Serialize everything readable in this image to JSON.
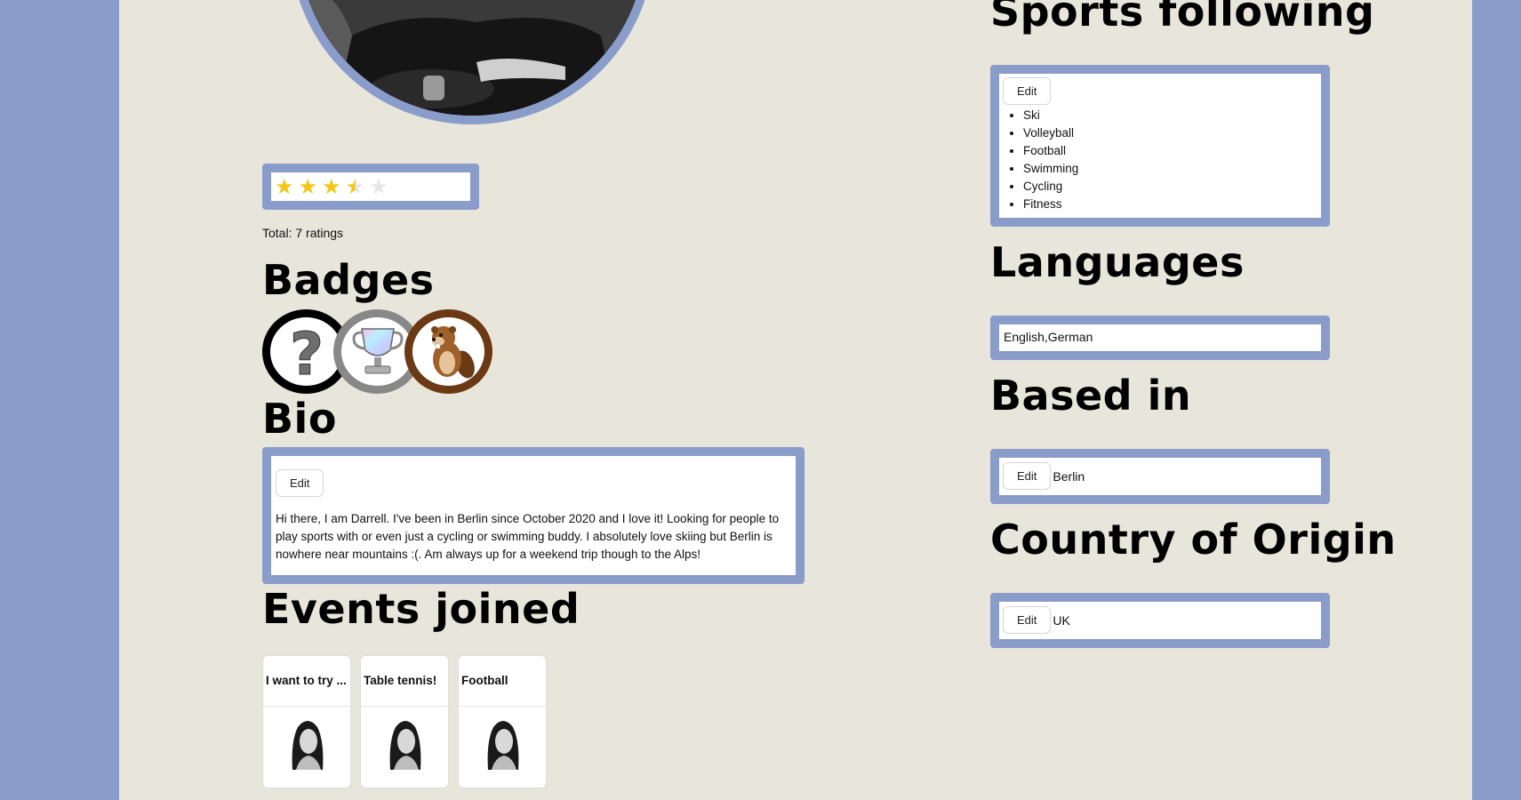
{
  "profile": {
    "rating": {
      "stars": [
        {
          "icon": "star-full-icon",
          "glyph": "★"
        },
        {
          "icon": "star-full-icon",
          "glyph": "★"
        },
        {
          "icon": "star-full-icon",
          "glyph": "★"
        },
        {
          "icon": "star-half-icon",
          "glyph": "★"
        },
        {
          "icon": "star-empty-icon",
          "glyph": "★"
        }
      ],
      "value": 3.5,
      "max": 5,
      "total_text": "Total: 7 ratings"
    }
  },
  "badges": {
    "title": "Badges",
    "items": [
      {
        "icon": "question-mark-icon",
        "ring_color": "#000000"
      },
      {
        "icon": "trophy-icon",
        "ring_color": "#888888"
      },
      {
        "icon": "beaver-icon",
        "ring_color": "#6b3a14"
      }
    ]
  },
  "bio": {
    "title": "Bio",
    "edit_label": "Edit",
    "text": "Hi there, I am Darrell. I've been in Berlin since October 2020 and I love it! Looking for people to play sports with or even just a cycling or swimming buddy. I absolutely love skiing but Berlin is nowhere near mountains :(. Am always up for a weekend trip though to the Alps!"
  },
  "events": {
    "title": "Events joined",
    "items": [
      {
        "title": "I want to try ..."
      },
      {
        "title": "Table tennis!"
      },
      {
        "title": "Football"
      }
    ]
  },
  "sports": {
    "title": "Sports following",
    "edit_label": "Edit",
    "items": [
      "Ski",
      "Volleyball",
      "Football",
      "Swimming",
      "Cycling",
      "Fitness"
    ]
  },
  "languages": {
    "title": "Languages",
    "value": "English,German"
  },
  "based_in": {
    "title": "Based in",
    "edit_label": "Edit",
    "value": "Berlin"
  },
  "country_of_origin": {
    "title": "Country of Origin",
    "edit_label": "Edit",
    "value": "UK"
  },
  "colors": {
    "background": "#8a9cca",
    "page": "#e8e5da",
    "frame": "#8a9cca",
    "star": "#f5c518"
  }
}
